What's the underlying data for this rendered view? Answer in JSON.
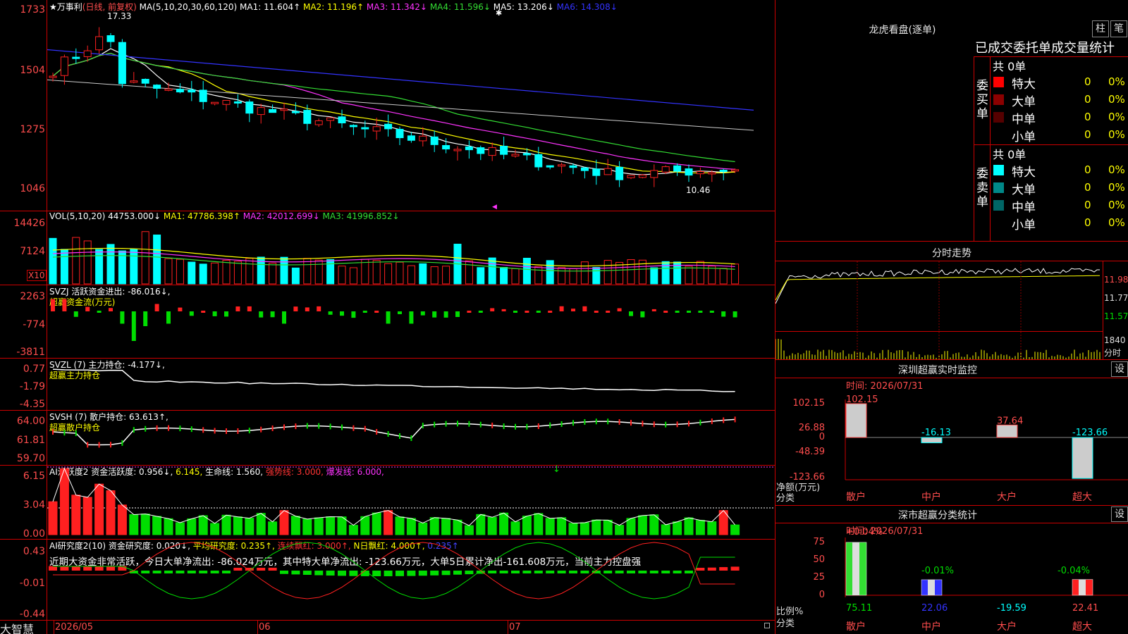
{
  "main": {
    "title": "★万事利",
    "period": "(日线, 前复权)",
    "ma_params": "MA(5,10,20,30,60,120)",
    "ma_items": [
      {
        "text": "MA1: 11.604↑",
        "color": "#ffffff"
      },
      {
        "text": "MA2: 11.196↑",
        "color": "#ffff00"
      },
      {
        "text": "MA3: 11.342↓",
        "color": "#ff33ff"
      },
      {
        "text": "MA4: 11.596↓",
        "color": "#33dd33"
      },
      {
        "text": "MA5: 13.206↓",
        "color": "#ffffff"
      },
      {
        "text": "MA6: 14.308↓",
        "color": "#3333ff"
      }
    ],
    "price_axis": [
      "1733",
      "1504",
      "1275",
      "1046"
    ],
    "high_label": "17.33",
    "low_label": "10.46"
  },
  "vol": {
    "params": "VOL(5,10,20)",
    "items": [
      {
        "text": "44753.000↓",
        "color": "#ffffff"
      },
      {
        "text": "MA1: 47786.398↑",
        "color": "#ffff00"
      },
      {
        "text": "MA2: 42012.699↓",
        "color": "#ff33ff"
      },
      {
        "text": "MA3: 41996.852↓",
        "color": "#33dd33"
      }
    ],
    "axis": [
      "14426",
      "7124"
    ],
    "unit": "X10"
  },
  "svzj": {
    "line1": "SVZJ  活跃资金进出: -86.016↓,",
    "line2": "超赢资金流(万元)",
    "axis": [
      "2263",
      "-774",
      "-3811"
    ]
  },
  "svzl": {
    "line1": "SVZL (7) 主力持仓: -4.177↓,",
    "line2": "超赢主力持仓",
    "axis": [
      "0.77",
      "-1.79",
      "-4.35"
    ]
  },
  "svsh": {
    "line1": "SVSH (7) 散户持仓: 63.613↑,",
    "line2": "超赢散户持仓",
    "axis": [
      "64.00",
      "61.81",
      "59.70"
    ]
  },
  "ai_active": {
    "items": [
      {
        "text": "AI活跃度2 资金活跃度: 0.956↓,",
        "color": "#ffffff"
      },
      {
        "text": "6.145,",
        "color": "#ffff00"
      },
      {
        "text": "生命线: 1.560,",
        "color": "#ffffff"
      },
      {
        "text": "强势线: 3.000,",
        "color": "#ff3333"
      },
      {
        "text": "爆发线: 6.000,",
        "color": "#ff33ff"
      }
    ],
    "axis": [
      "6.15",
      "3.04",
      "0.00"
    ]
  },
  "ai_research": {
    "items": [
      {
        "text": "AI研究度2(10) 资金研究度: 0.020↓,",
        "color": "#ffffff"
      },
      {
        "text": "平均研究度: 0.235↑,",
        "color": "#ffff00"
      },
      {
        "text": "连续飘红: 3.000↑,",
        "color": "#ff3333"
      },
      {
        "text": "N日飘红: 4.000↑,",
        "color": "#ffff00"
      },
      {
        "text": "0.235↑",
        "color": "#4444ff"
      }
    ],
    "summary": "近期大资金非常活跃，今日大单净流出: -86.024万元，其中特大单净流出: -123.66万元，大单5日累计净出-161.608万元，当前主力控盘强",
    "axis": [
      "0.43",
      "-0.01",
      "-0.44"
    ]
  },
  "bottom": {
    "brand": "大智慧",
    "dates": [
      "2026/05",
      "06",
      "07"
    ]
  },
  "dragon": {
    "title": "龙虎看盘(逐单)",
    "btn_zhu": "柱",
    "btn_bi": "笔",
    "subtitle": "已成交委托单成交量统计",
    "buy_label": "委买单",
    "sell_label": "委卖单",
    "buy_total": "共 0单",
    "sell_total": "共 0单",
    "buy_rows": [
      {
        "label": "特大",
        "val": "0",
        "pct": "0%",
        "color": "#ff0000"
      },
      {
        "label": "大单",
        "val": "0",
        "pct": "0%",
        "color": "#8b0000"
      },
      {
        "label": "中单",
        "val": "0",
        "pct": "0%",
        "color": "#550000"
      },
      {
        "label": "小单",
        "val": "0",
        "pct": "0%",
        "color": "#000000"
      }
    ],
    "sell_rows": [
      {
        "label": "特大",
        "val": "0",
        "pct": "0%",
        "color": "#00ffff"
      },
      {
        "label": "大单",
        "val": "0",
        "pct": "0%",
        "color": "#008888"
      },
      {
        "label": "中单",
        "val": "0",
        "pct": "0%",
        "color": "#006666"
      },
      {
        "label": "小单",
        "val": "0",
        "pct": "0%",
        "color": "#000000"
      }
    ]
  },
  "intraday": {
    "title": "分时走势",
    "axis": [
      {
        "text": "11.98",
        "color": "#ff4d4d"
      },
      {
        "text": "11.77",
        "color": "#dddddd"
      },
      {
        "text": "11.57",
        "color": "#00dd00"
      },
      {
        "text": "1840",
        "color": "#dddddd"
      },
      {
        "text": "分时",
        "color": "#dddddd"
      }
    ]
  },
  "sz_monitor": {
    "title": "深圳超赢实时监控",
    "btn": "设",
    "time": "时间: 2026/07/31",
    "axis": [
      "102.15",
      "26.88",
      "0",
      "-48.39",
      "-123.66"
    ],
    "left_label1": "净额(万元)",
    "left_label2": "分类",
    "bars": [
      {
        "label": "散户",
        "value": 102.15,
        "text": "102.15",
        "text_color": "#ff4d4d",
        "fill": "#cccccc"
      },
      {
        "label": "中户",
        "value": -16.13,
        "text": "-16.13",
        "text_color": "#00ffff",
        "fill": "#cccccc"
      },
      {
        "label": "大户",
        "value": 37.64,
        "text": "37.64",
        "text_color": "#ff4d4d",
        "fill": "#cccccc"
      },
      {
        "label": "超大",
        "value": -123.66,
        "text": "-123.66",
        "text_color": "#00ffff",
        "fill": "#cccccc"
      }
    ]
  },
  "sz_class": {
    "title": "深市超赢分类统计",
    "btn": "设",
    "time": "时间: 2026/07/31",
    "axis": [
      "75",
      "50",
      "25",
      "0"
    ],
    "left_label1": "比例%",
    "left_label2": "分类",
    "top_labels": [
      {
        "text": "+0.04%",
        "color": "#ff4d4d"
      },
      {
        "text": "-0.01%",
        "color": "#00dd00"
      },
      {
        "text": "-0.04%",
        "color": "#00dd00"
      }
    ],
    "bars": [
      {
        "label": "散户",
        "value": 75.11,
        "text": "75.11",
        "text_color": "#00dd00"
      },
      {
        "label": "中户",
        "value": 22.06,
        "text": "22.06",
        "text_color": "#3333ff"
      },
      {
        "label": "大户",
        "value": -19.59,
        "text": "-19.59",
        "text_color": "#00ffff"
      },
      {
        "label": "超大",
        "value": 22.41,
        "text": "22.41",
        "text_color": "#ff4d4d"
      }
    ]
  },
  "colors": {
    "up": "#ff2020",
    "down": "#00ffff",
    "axis": "#c00000",
    "green": "#00dd00"
  }
}
